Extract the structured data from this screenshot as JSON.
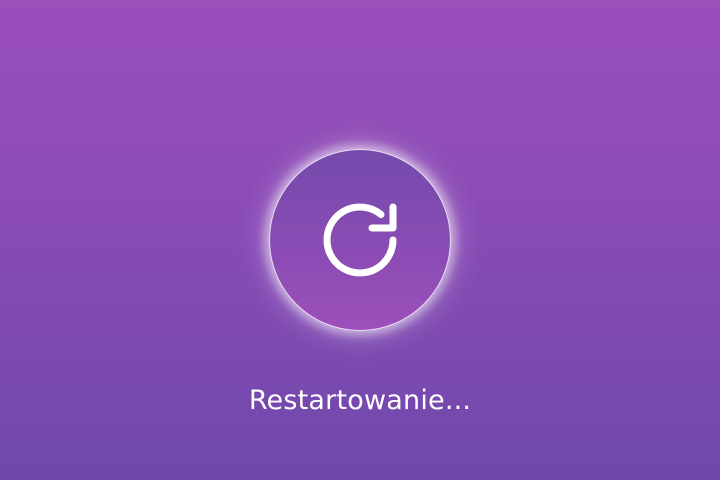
{
  "status": {
    "text": "Restartowanie..."
  },
  "icon": {
    "name": "restart-icon"
  },
  "colors": {
    "background_top": "#9a4fbb",
    "background_bottom": "#6f48ab",
    "circle_top": "#744aac",
    "circle_bottom": "#9c4fbb",
    "foreground": "#ffffff"
  }
}
